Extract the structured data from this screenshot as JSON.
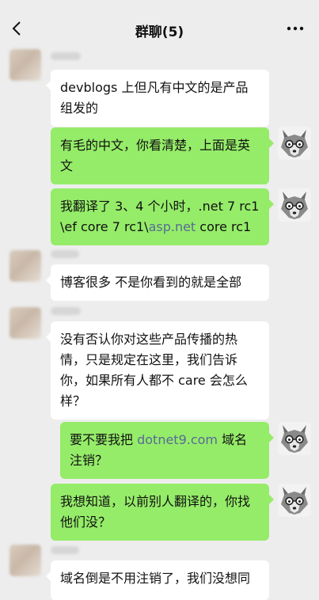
{
  "header": {
    "title": "群聊(5)",
    "back_icon": "chevron-left-icon",
    "more_icon": "more-horizontal-icon"
  },
  "messages": [
    {
      "side": "in",
      "text": "devblogs 上但凡有中文的是产品组发的"
    },
    {
      "side": "out",
      "text": "有毛的中文，你看清楚，上面是英文"
    },
    {
      "side": "out",
      "text_a": "我翻译了 3、4 个小时，.net 7 rc1 \\ef core 7 rc1\\",
      "link": "asp.net",
      "text_b": " core rc1"
    },
    {
      "side": "in",
      "text": "博客很多 不是你看到的就是全部"
    },
    {
      "side": "in",
      "text": "没有否认你对这些产品传播的热情，只是规定在这里，我们告诉你，如果所有人都不 care 会怎么样？"
    },
    {
      "side": "out",
      "text_a": "要不要我把 ",
      "link": "dotnet9.com",
      "text_b": " 域名注销？"
    },
    {
      "side": "out",
      "text": "我想知道，以前别人翻译的，你找他们没？"
    },
    {
      "side": "in",
      "text": "域名倒是不用注销了，我们没想同"
    }
  ],
  "colors": {
    "background": "#ededed",
    "outgoing_bubble": "#95ec69",
    "incoming_bubble": "#ffffff",
    "link": "#576b95"
  }
}
